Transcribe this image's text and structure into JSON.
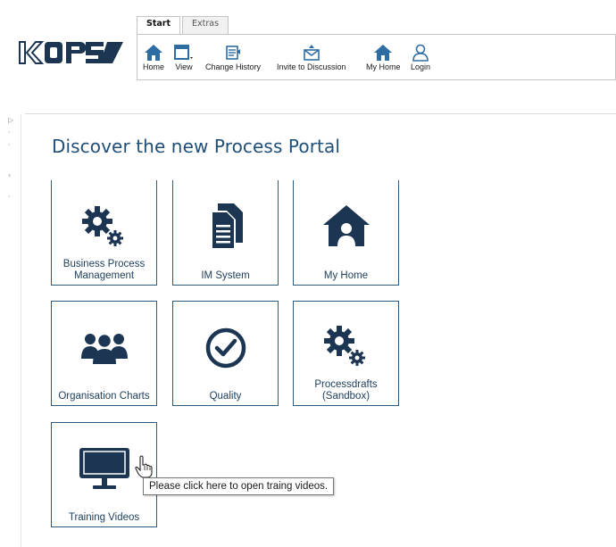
{
  "brand": {
    "logo_text": "KOPS",
    "accent_color": "#1f4f78",
    "tile_border_color": "#2b5a82",
    "icon_color": "#1b3552"
  },
  "ribbon": {
    "tabs": [
      {
        "label": "Start",
        "active": true
      },
      {
        "label": "Extras",
        "active": false
      }
    ],
    "buttons": [
      {
        "label": "Home",
        "icon": "home-icon"
      },
      {
        "label": "View",
        "icon": "window-icon"
      },
      {
        "label": "Change History",
        "icon": "history-icon"
      },
      {
        "label": "Invite to Discussion",
        "icon": "envelope-icon"
      },
      {
        "label": "My Home",
        "icon": "home-icon"
      },
      {
        "label": "Login",
        "icon": "user-icon"
      }
    ]
  },
  "portal": {
    "title": "Discover the new Process Portal",
    "tiles": [
      {
        "label": "Business Process Management",
        "icon": "gears-icon"
      },
      {
        "label": "IM System",
        "icon": "documents-icon"
      },
      {
        "label": "My Home",
        "icon": "home-user-icon"
      },
      {
        "label": "Organisation Charts",
        "icon": "group-icon"
      },
      {
        "label": "Quality",
        "icon": "check-circle-icon"
      },
      {
        "label": "Processdrafts (Sandbox)",
        "icon": "gears-icon"
      },
      {
        "label": "Training Videos",
        "icon": "monitor-icon"
      }
    ]
  },
  "tooltip": {
    "text": "Please click here to open traing videos."
  }
}
